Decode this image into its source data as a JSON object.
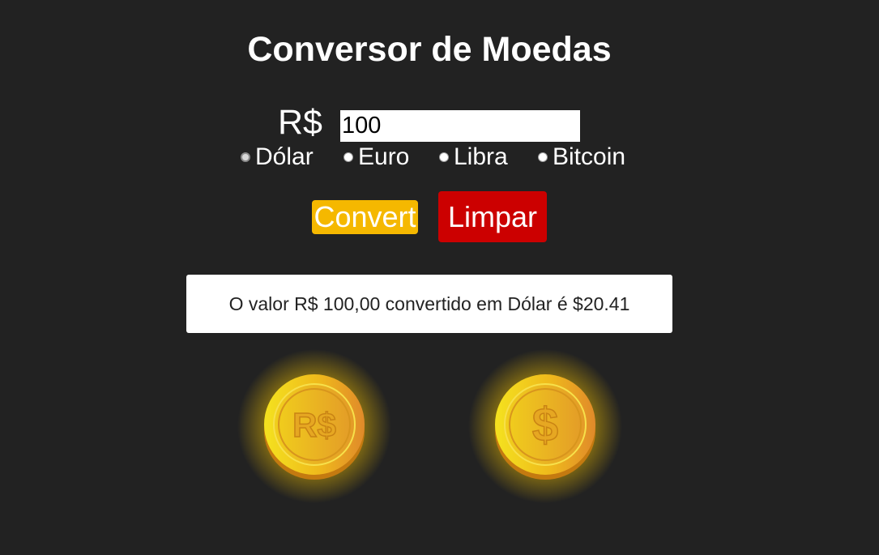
{
  "header": {
    "title": "Conversor de Moedas"
  },
  "form": {
    "currency_prefix": "R$",
    "amount_value": "100",
    "currency_options": [
      {
        "label": "Dólar",
        "checked": true
      },
      {
        "label": "Euro",
        "checked": false
      },
      {
        "label": "Libra",
        "checked": false
      },
      {
        "label": "Bitcoin",
        "checked": false
      }
    ]
  },
  "actions": {
    "convert_label": "Convert",
    "clear_label": "Limpar"
  },
  "result": {
    "text": "O valor R$ 100,00 convertido em Dólar é $20.41"
  },
  "coins": {
    "left_symbol": "R$",
    "right_symbol": "$"
  },
  "colors": {
    "background": "#222222",
    "convert_button": "#f5b800",
    "clear_button": "#cc0000",
    "coin_gold": "#f2c21a"
  }
}
